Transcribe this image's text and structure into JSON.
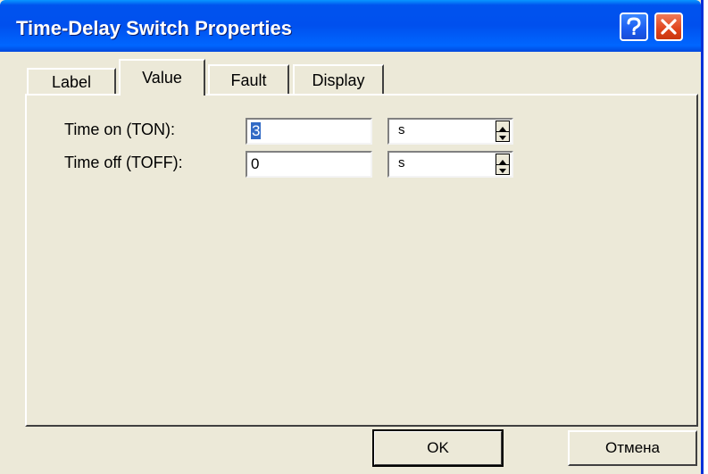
{
  "window": {
    "title": "Time-Delay Switch Properties",
    "help_icon": "question-mark-icon",
    "close_icon": "close-x-icon"
  },
  "tabs": [
    {
      "label": "Label",
      "active": false
    },
    {
      "label": "Value",
      "active": true
    },
    {
      "label": "Fault",
      "active": false
    },
    {
      "label": "Display",
      "active": false
    }
  ],
  "fields": {
    "ton": {
      "label": "Time on (TON):",
      "value": "3",
      "unit": "s"
    },
    "toff": {
      "label": "Time off (TOFF):",
      "value": "0",
      "unit": "s"
    }
  },
  "buttons": {
    "ok": "OK",
    "cancel": "Отмена"
  },
  "colors": {
    "titlebar": "#0053ee",
    "face": "#ece9d8",
    "close": "#e0441c",
    "selection": "#316ac5"
  }
}
